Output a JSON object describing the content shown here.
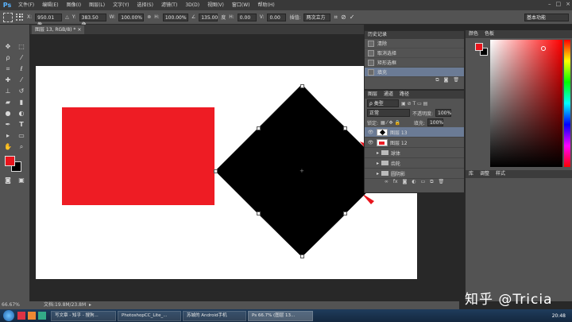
{
  "app": {
    "logo": "Ps"
  },
  "menu": [
    "文件(F)",
    "编辑(E)",
    "图像(I)",
    "图层(L)",
    "文字(Y)",
    "选择(S)",
    "滤镜(T)",
    "3D(D)",
    "视图(V)",
    "窗口(W)",
    "帮助(H)"
  ],
  "options": {
    "x_label": "X:",
    "x_value": "950.01 像",
    "y_label": "Y:",
    "y_value": "383.50 像",
    "w_label": "W:",
    "w_value": "100.00%",
    "h_label": "H:",
    "h_value": "100.00%",
    "angle_value": "135.00",
    "angle_unit": "度",
    "hskew_label": "H:",
    "hskew_value": "0.00",
    "vskew_label": "V:",
    "vskew_value": "0.00",
    "interp_label": "插值:",
    "interp_value": "两次立方",
    "workspace": "基本功能"
  },
  "document": {
    "tab": "图层 13, RGB/8) *",
    "tab_close": "×"
  },
  "status": {
    "zoom": "66.67%",
    "doc": "文档:19.8M/23.8M"
  },
  "history": {
    "tabs": [
      "历史记录"
    ],
    "items": [
      {
        "label": "清除",
        "selected": false
      },
      {
        "label": "取消选择",
        "selected": false
      },
      {
        "label": "矩形选框",
        "selected": false
      },
      {
        "label": "填充",
        "selected": true
      }
    ]
  },
  "layers": {
    "tabs": [
      "图层",
      "通道",
      "路径"
    ],
    "kind": "ρ 类型",
    "blend": "正常",
    "opacity_label": "不透明度:",
    "opacity": "100%",
    "lock_label": "锁定:",
    "fill_label": "填充:",
    "fill": "100%",
    "items": [
      {
        "name": "图层 13",
        "selected": true,
        "group": false,
        "thumb": "diamond"
      },
      {
        "name": "图层 12",
        "selected": false,
        "group": false,
        "thumb": "red"
      },
      {
        "name": "球体",
        "selected": false,
        "group": true
      },
      {
        "name": "齿轮",
        "selected": false,
        "group": true
      },
      {
        "name": "圆阴影",
        "selected": false,
        "group": true
      }
    ]
  },
  "right_panels": {
    "color_tabs": [
      "颜色",
      "色板"
    ],
    "adjust_tabs": [
      "库",
      "调整",
      "样式"
    ]
  },
  "colors": {
    "foreground": "#e8141c",
    "background": "#000000",
    "rect": "#ee1c24"
  },
  "taskbar": {
    "tasks": [
      "写文章 - 知乎 - 搜狗...",
      "PhotoshopCC_Lite_...",
      "苏城的 Android手机",
      "Ps  66.7% (图层 13..."
    ],
    "clock": "20:48"
  },
  "watermark": "知乎 @Tricia"
}
